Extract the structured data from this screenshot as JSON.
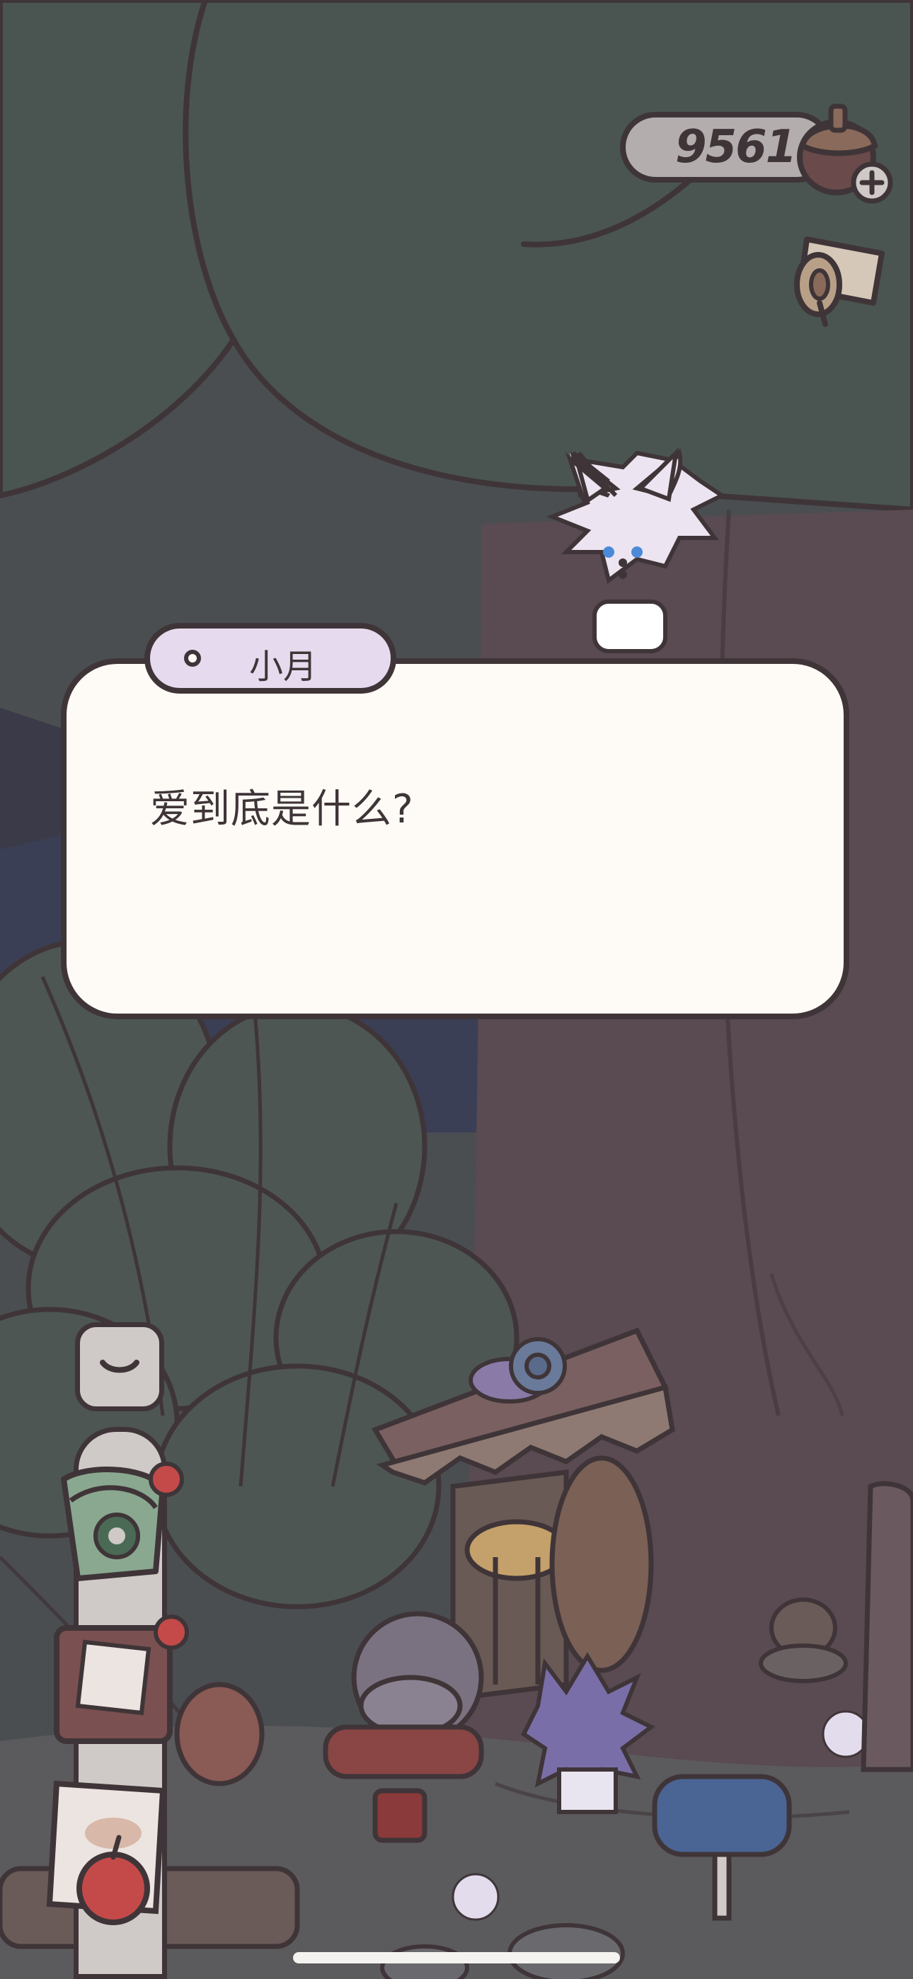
{
  "hud": {
    "acorn_count": "9561",
    "acorn_icon": "acorn-plus-icon",
    "notice_icon": "notice-scroll-icon"
  },
  "dialog": {
    "speaker": "小月",
    "text": "爱到底是什么?"
  },
  "toolbar": {
    "collapse_icon": "chevron-down-icon",
    "items": [
      "knit-bag-icon",
      "journal-book-icon",
      "letters-apple-icon"
    ]
  },
  "colors": {
    "outline": "#3f3538",
    "dialog_bg": "#fefbf6",
    "name_tag_bg": "#e6dbee",
    "counter_bg": "#b4adad",
    "tree_canopy": "#4a5551",
    "sky_dark": "#4a4e51",
    "trunk": "#5a4a52"
  }
}
